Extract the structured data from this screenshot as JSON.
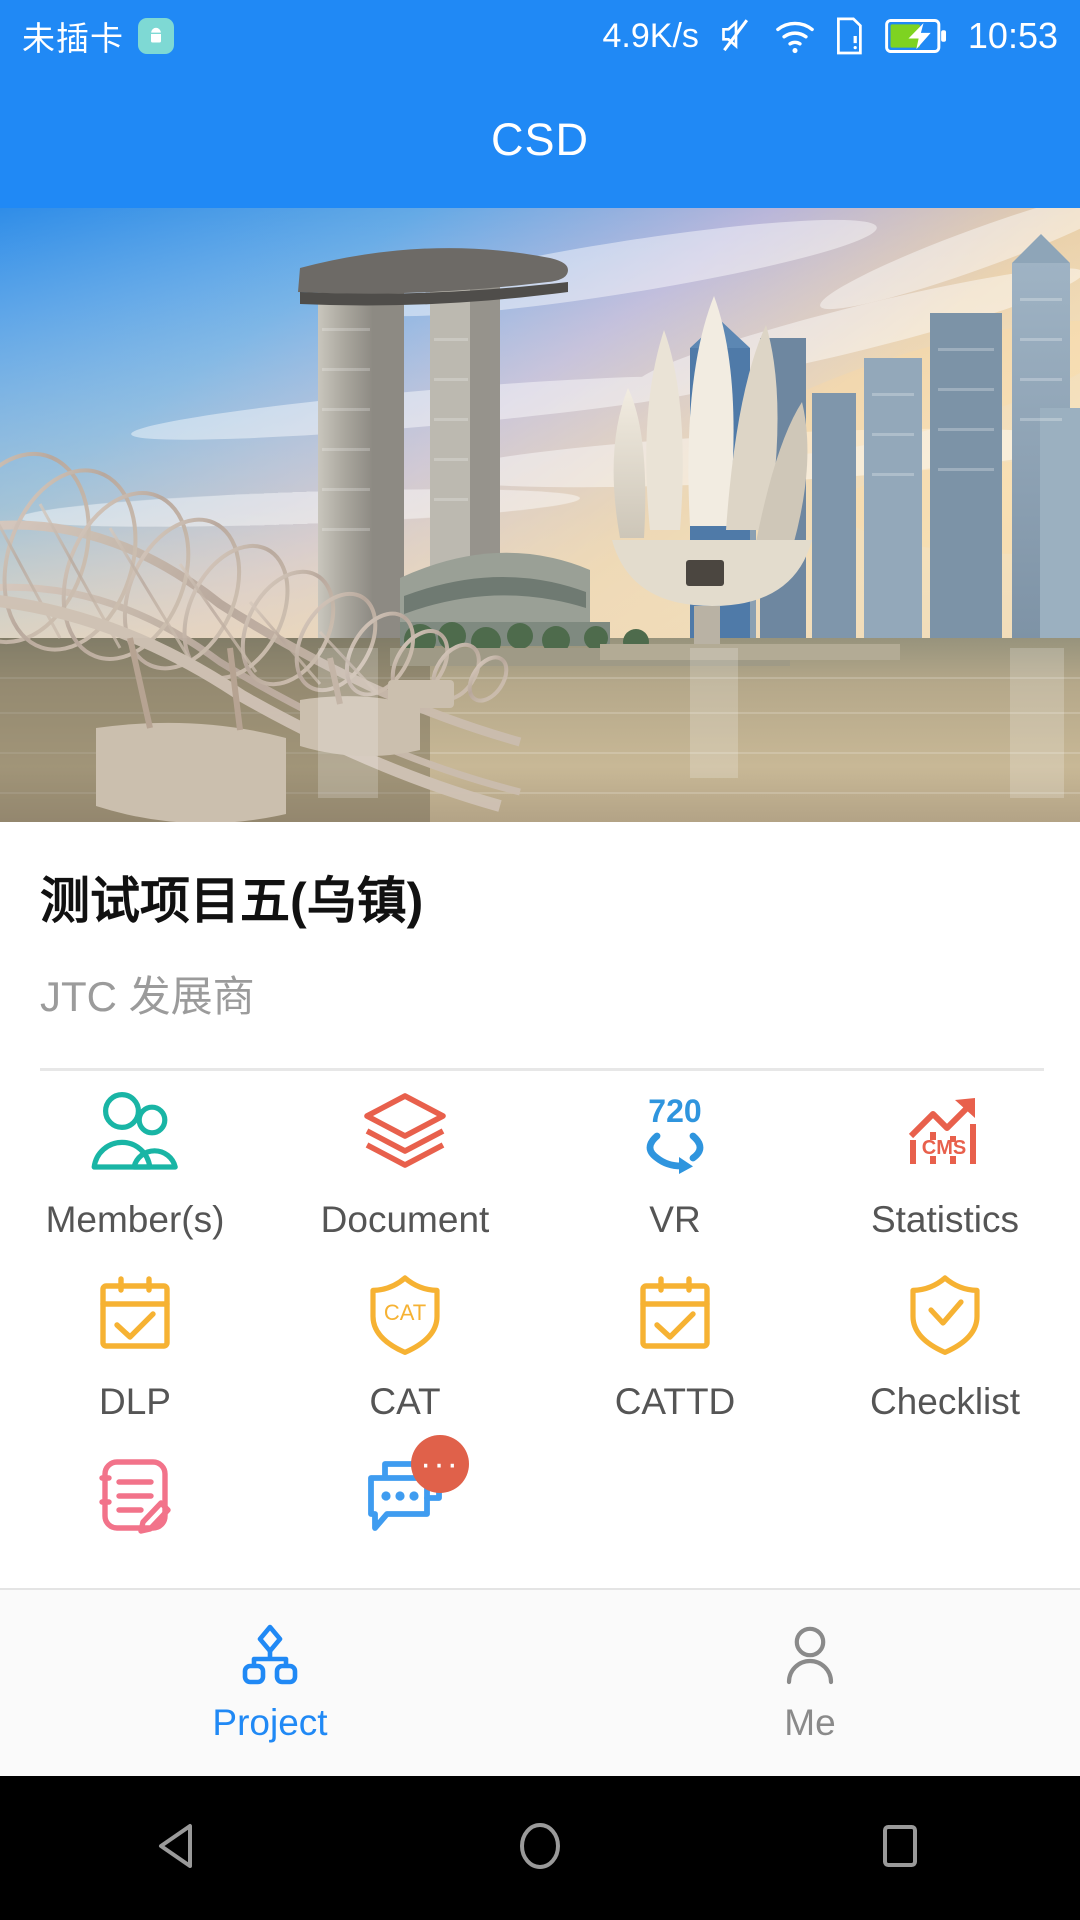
{
  "status_bar": {
    "carrier": "未插卡",
    "android_icon": "android-robot-icon",
    "network_speed": "4.9K/s",
    "mute_icon": "mute-icon",
    "wifi_icon": "wifi-icon",
    "sim_icon": "sim-card-alert-icon",
    "battery_icon": "battery-charging-icon",
    "clock": "10:53"
  },
  "app_bar": {
    "title": "CSD",
    "background_color": "#2089f5"
  },
  "banner": {
    "alt": "marina-bay-sands-skyline-photo"
  },
  "project": {
    "title": "测试项目五(乌镇)",
    "subtitle": "JTC 发展商"
  },
  "grid": {
    "items": [
      {
        "label": "Member(s)",
        "icon": "members-icon",
        "color": "#19b5a5",
        "badge": null
      },
      {
        "label": "Document",
        "icon": "layers-icon",
        "color": "#e8604c",
        "badge": null
      },
      {
        "label": "VR",
        "icon": "vr-720-icon",
        "color": "#2f95de",
        "badge": null
      },
      {
        "label": "Statistics",
        "icon": "cms-chart-icon",
        "color": "#e8604c",
        "badge": null
      },
      {
        "label": "DLP",
        "icon": "calendar-check-icon",
        "color": "#f6b233",
        "badge": null
      },
      {
        "label": "CAT",
        "icon": "shield-cat-icon",
        "color": "#f6b233",
        "badge": null
      },
      {
        "label": "CATTD",
        "icon": "calendar-check-icon",
        "color": "#f6b233",
        "badge": null
      },
      {
        "label": "Checklist",
        "icon": "shield-check-icon",
        "color": "#f6b233",
        "badge": null
      },
      {
        "label": "",
        "icon": "note-edit-icon",
        "color": "#f2738a",
        "badge": null
      },
      {
        "label": "",
        "icon": "chat-bubbles-icon",
        "color": "#3f9cf0",
        "badge": "···"
      }
    ],
    "vr_icon_text": "720",
    "statistics_icon_text": "CMS",
    "cat_icon_text": "CAT"
  },
  "bottom_nav": {
    "items": [
      {
        "label": "Project",
        "icon": "sitemap-icon",
        "active": true,
        "color": "#2089f5"
      },
      {
        "label": "Me",
        "icon": "person-icon",
        "active": false,
        "color": "#8a8a8a"
      }
    ]
  },
  "system_nav": {
    "back": "back-triangle-icon",
    "home": "home-circle-icon",
    "recents": "recents-square-icon"
  }
}
